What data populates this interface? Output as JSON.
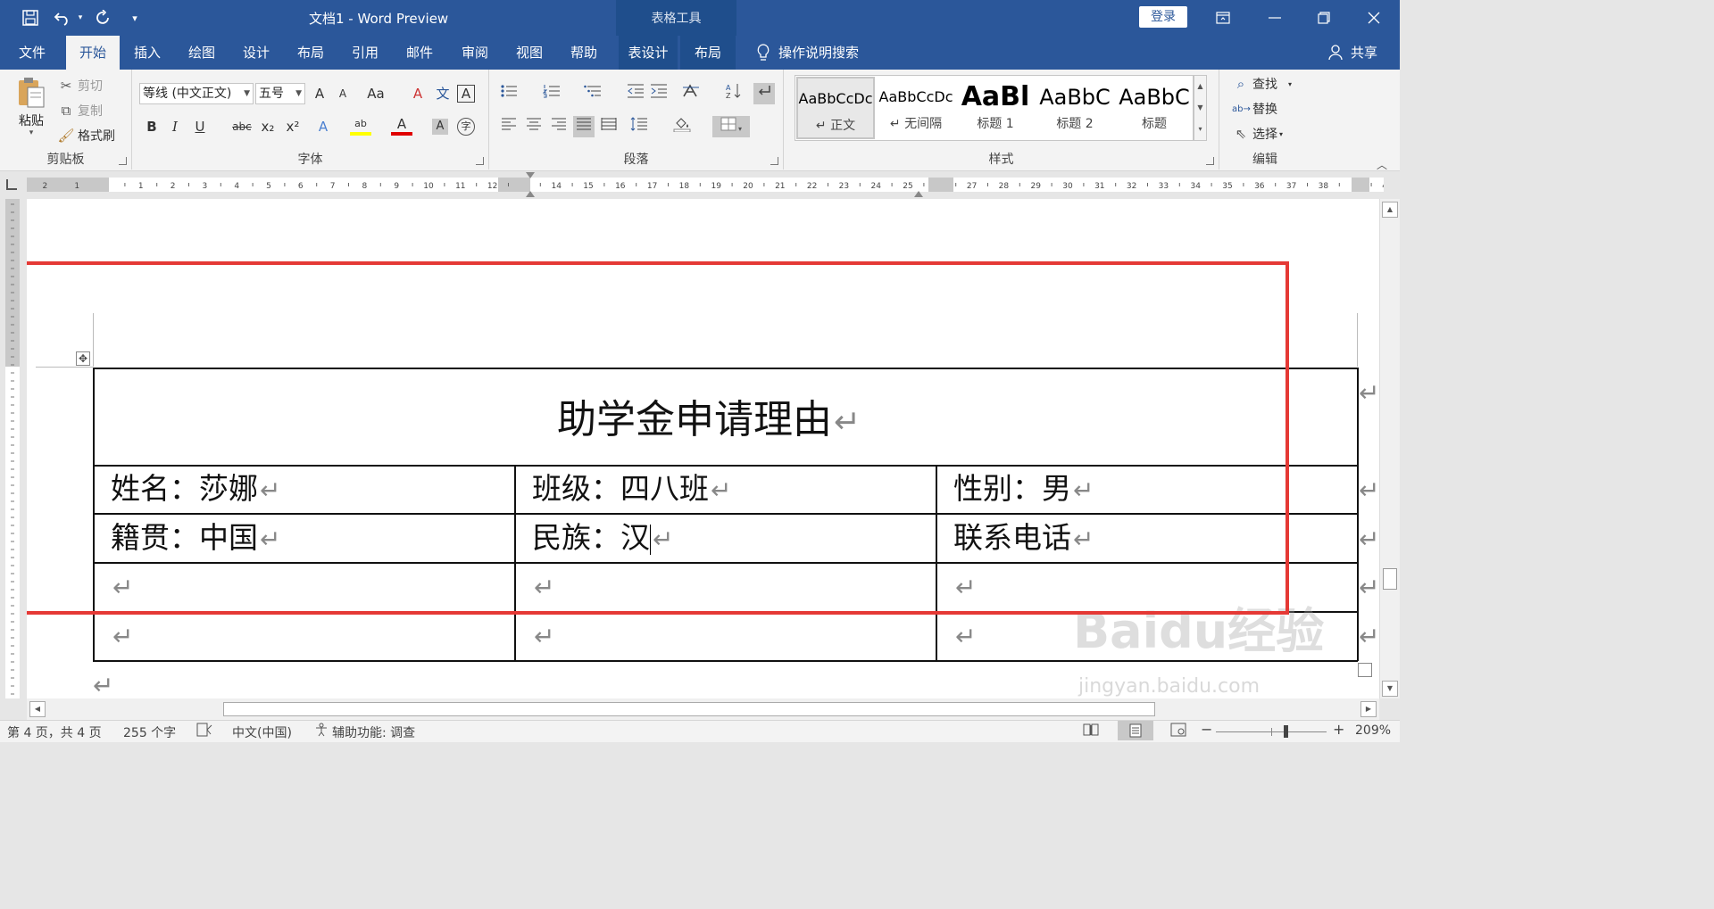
{
  "title_bar": {
    "doc_title": "文档1  -  Word Preview",
    "context_group": "表格工具",
    "login_label": "登录",
    "customize": "▾",
    "save_icon": "save-icon",
    "undo_icon": "undo-icon",
    "redo_icon": "redo-icon"
  },
  "tabs": {
    "file": "文件",
    "home": "开始",
    "insert": "插入",
    "draw": "绘图",
    "design": "设计",
    "layout": "布局",
    "references": "引用",
    "mailings": "邮件",
    "review": "审阅",
    "view": "视图",
    "help": "帮助",
    "table_design": "表设计",
    "table_layout": "布局",
    "search": "操作说明搜索",
    "share": "共享"
  },
  "ribbon": {
    "clipboard": {
      "group": "剪贴板",
      "paste": "粘贴",
      "cut": "剪切",
      "copy": "复制",
      "format_painter": "格式刷"
    },
    "font": {
      "group": "字体",
      "font_name": "等线 (中文正文)",
      "font_size": "五号",
      "grow": "A",
      "shrink": "A",
      "change_case": "Aa",
      "clear": "A",
      "phonetic": "文",
      "border_char": "A",
      "bold": "B",
      "italic": "I",
      "underline": "U",
      "strike": "abc",
      "subscript": "x₂",
      "superscript": "x²",
      "text_effect": "A",
      "highlight": "ab",
      "font_color": "A",
      "char_shading": "A",
      "enclose": "字"
    },
    "paragraph": {
      "group": "段落"
    },
    "styles": {
      "group": "样式",
      "items": [
        {
          "sample": "AaBbCcDc",
          "name": "↵ 正文"
        },
        {
          "sample": "AaBbCcDc",
          "name": "↵ 无间隔"
        },
        {
          "sample": "AaBl",
          "name": "标题 1"
        },
        {
          "sample": "AaBbC",
          "name": "标题 2"
        },
        {
          "sample": "AaBbC",
          "name": "标题"
        }
      ]
    },
    "editing": {
      "group": "编辑",
      "find": "查找",
      "replace": "替换",
      "select": "选择"
    }
  },
  "ruler": {
    "h_left": [
      "2",
      "1"
    ],
    "h_ticks": [
      "1",
      "2",
      "3",
      "4",
      "5",
      "6",
      "7",
      "8",
      "9",
      "10",
      "11",
      "12",
      "",
      "14",
      "15",
      "16",
      "17",
      "18",
      "19",
      "20",
      "21",
      "22",
      "23",
      "24",
      "25",
      "",
      "27",
      "28",
      "29",
      "30",
      "31",
      "32",
      "33",
      "34",
      "35",
      "36",
      "37",
      "38",
      "",
      "40"
    ]
  },
  "document": {
    "table": {
      "title": "助学金申请理由",
      "rows": [
        [
          "姓名：莎娜",
          "班级：四八班",
          "性别：男"
        ],
        [
          "籍贯：中国",
          "民族：汉",
          "联系电话"
        ],
        [
          "",
          "",
          ""
        ],
        [
          "",
          "",
          ""
        ]
      ]
    },
    "para_mark": "↵",
    "watermark": "Baidu经验",
    "watermark_url": "jingyan.baidu.com"
  },
  "status_bar": {
    "page": "第 4 页，共 4 页",
    "words": "255 个字",
    "language": "中文(中国)",
    "accessibility": "辅助功能: 调查",
    "zoom": "209%"
  },
  "colors": {
    "accent": "#2b579a",
    "highlight_box": "#e53935"
  }
}
